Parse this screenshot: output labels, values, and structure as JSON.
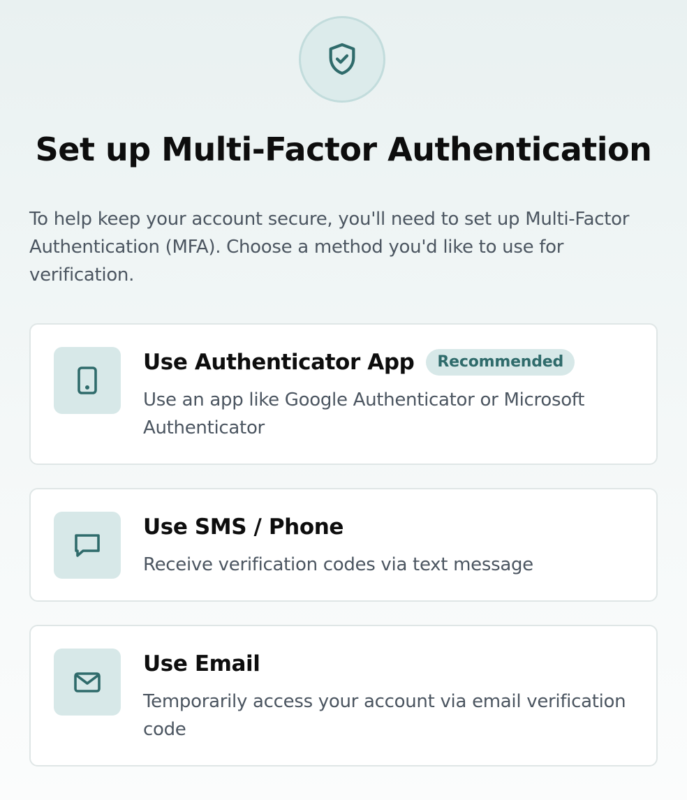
{
  "header": {
    "title": "Set up Multi-Factor Authentication",
    "description": "To help keep your account secure, you'll need to set up Multi-Factor Authentication (MFA). Choose a method you'd like to use for verification.",
    "icon": "shield-check-icon"
  },
  "options": [
    {
      "title": "Use Authenticator App",
      "badge": "Recommended",
      "description": "Use an app like Google Authenticator or Microsoft Authenticator",
      "icon": "tablet-icon"
    },
    {
      "title": "Use SMS / Phone",
      "description": "Receive verification codes via text message",
      "icon": "message-icon"
    },
    {
      "title": "Use Email",
      "description": "Temporarily access your account via email verification code",
      "icon": "mail-icon"
    }
  ],
  "colors": {
    "accent": "#2f6b6b",
    "icon_bg": "#d7e8e8",
    "card_border": "#dfe6e6",
    "muted_text": "#4b5560"
  }
}
